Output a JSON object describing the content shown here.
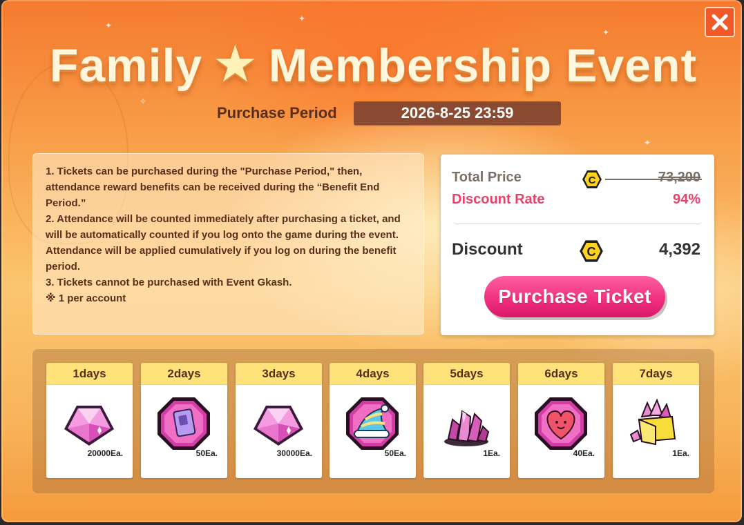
{
  "title_left": "Family",
  "title_right": "Membership Event",
  "purchase_period": {
    "label": "Purchase Period",
    "value": "2026-8-25 23:59"
  },
  "notice_lines": [
    "1. Tickets can be purchased during the \"Purchase Period,\" then, attendance reward benefits can be received during the “Benefit End Period.”",
    "2. Attendance will be counted immediately after purchasing a ticket, and will be automatically counted if you log onto the game during the event. Attendance will be applied cumulatively if you log on during the benefit period.",
    "3. Tickets cannot be purchased with Event Gkash.",
    "※ 1 per account"
  ],
  "price_box": {
    "total_label": "Total Price",
    "total_value": "73,200",
    "discount_rate_label": "Discount Rate",
    "discount_rate_value": "94%",
    "discount_label": "Discount",
    "discount_value": "4,392",
    "currency_icon": "c-coin-icon",
    "purchase_button": "Purchase Ticket"
  },
  "rewards": [
    {
      "day": "1days",
      "qty": "20000Ea.",
      "icon": "pink-gem-icon"
    },
    {
      "day": "2days",
      "qty": "50Ea.",
      "icon": "card-badge-icon"
    },
    {
      "day": "3days",
      "qty": "30000Ea.",
      "icon": "pink-gem-icon"
    },
    {
      "day": "4days",
      "qty": "50Ea.",
      "icon": "nightcap-badge-icon"
    },
    {
      "day": "5days",
      "qty": "1Ea.",
      "icon": "crystal-cluster-icon"
    },
    {
      "day": "6days",
      "qty": "40Ea.",
      "icon": "heart-badge-icon"
    },
    {
      "day": "7days",
      "qty": "1Ea.",
      "icon": "crystal-box-icon"
    }
  ],
  "colors": {
    "accent_pink": "#ef2d7e",
    "discount_text": "#e8416d",
    "close_button": "#f05a2a",
    "day_header": "#ffe27a"
  }
}
